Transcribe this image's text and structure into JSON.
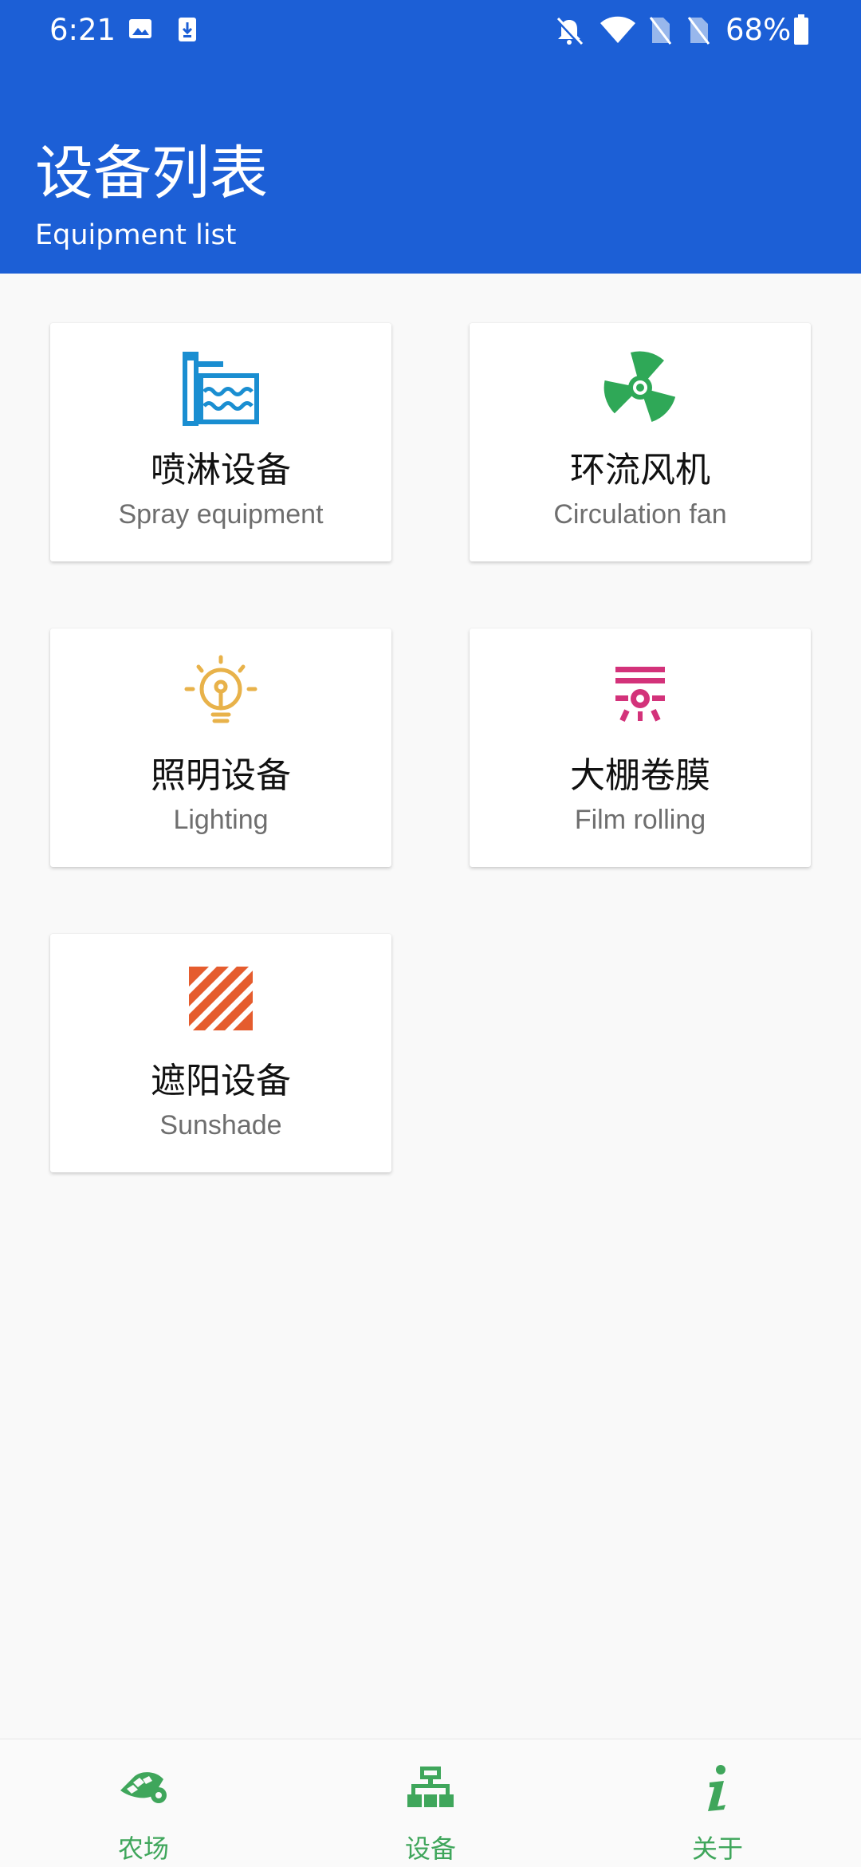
{
  "status_bar": {
    "time": "6:21",
    "battery_percent": "68%"
  },
  "header": {
    "title_cn": "设备列表",
    "title_en": "Equipment list"
  },
  "cards": [
    {
      "label_cn": "喷淋设备",
      "label_en": "Spray equipment",
      "icon": "spray-icon",
      "color": "#1a8ed1"
    },
    {
      "label_cn": "环流风机",
      "label_en": "Circulation fan",
      "icon": "fan-icon",
      "color": "#2fa857"
    },
    {
      "label_cn": "照明设备",
      "label_en": "Lighting",
      "icon": "bulb-icon",
      "color": "#e8b24a"
    },
    {
      "label_cn": "大棚卷膜",
      "label_en": "Film rolling",
      "icon": "film-rolling-icon",
      "color": "#d3327a"
    },
    {
      "label_cn": "遮阳设备",
      "label_en": "Sunshade",
      "icon": "sunshade-icon",
      "color": "#e55c2e"
    }
  ],
  "bottom_nav": {
    "accent_color": "#3fa65b",
    "items": [
      {
        "label": "农场",
        "icon": "farm-icon"
      },
      {
        "label": "设备",
        "icon": "devices-icon"
      },
      {
        "label": "关于",
        "icon": "info-icon"
      }
    ]
  }
}
